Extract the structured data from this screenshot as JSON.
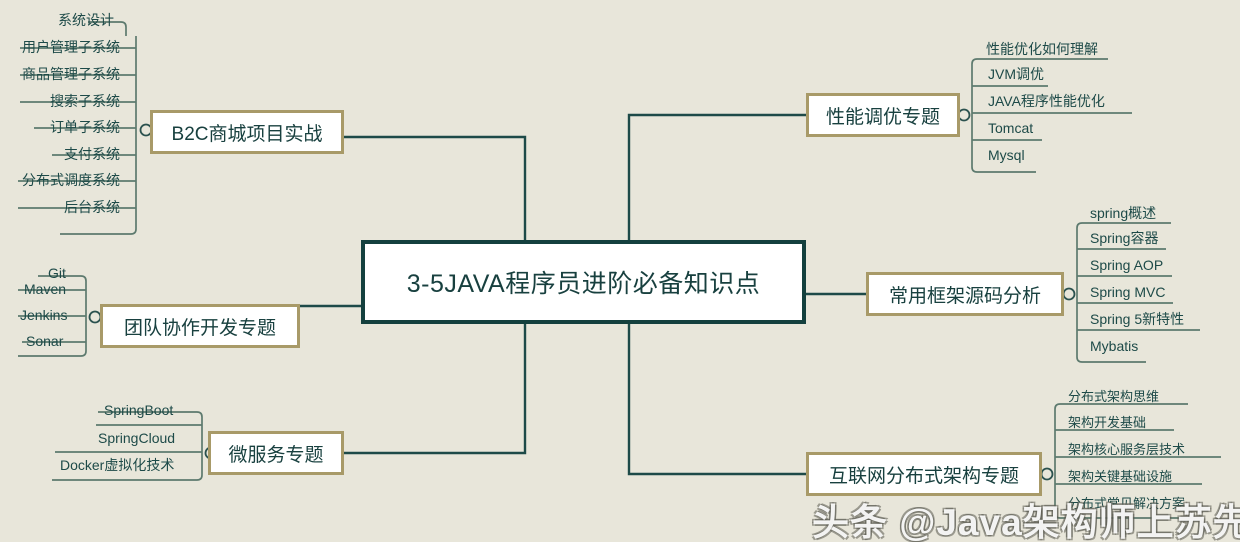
{
  "diagram": {
    "title": "3-5JAVA程序员进阶必备知识点",
    "background_color": "#e8e6da",
    "center_border_color": "#14403e",
    "branch_border_color": "#a89a68",
    "line_color": "#1d4a48",
    "text_color": "#18403f"
  },
  "center": {
    "label": "3-5JAVA程序员进阶必备知识点"
  },
  "branches": {
    "b2c": {
      "label": "B2C商城项目实战",
      "leaves": [
        {
          "label": "系统设计"
        },
        {
          "label": "用户管理子系统"
        },
        {
          "label": "商品管理子系统"
        },
        {
          "label": "搜索子系统"
        },
        {
          "label": "订单子系统"
        },
        {
          "label": "支付系统"
        },
        {
          "label": "分布式调度系统"
        },
        {
          "label": "后台系统"
        }
      ]
    },
    "team": {
      "label": "团队协作开发专题",
      "leaves": [
        {
          "label": "Git"
        },
        {
          "label": "Maven"
        },
        {
          "label": "Jenkins"
        },
        {
          "label": "Sonar"
        }
      ]
    },
    "micro": {
      "label": "微服务专题",
      "leaves": [
        {
          "label": "SpringBoot"
        },
        {
          "label": "SpringCloud"
        },
        {
          "label": "Docker虚拟化技术"
        }
      ]
    },
    "perf": {
      "label": "性能调优专题",
      "leaves": [
        {
          "label": "性能优化如何理解"
        },
        {
          "label": "JVM调优"
        },
        {
          "label": "JAVA程序性能优化"
        },
        {
          "label": "Tomcat"
        },
        {
          "label": "Mysql"
        }
      ]
    },
    "framework": {
      "label": "常用框架源码分析",
      "leaves": [
        {
          "label": "spring概述"
        },
        {
          "label": "Spring容器"
        },
        {
          "label": "Spring AOP"
        },
        {
          "label": "Spring MVC"
        },
        {
          "label": "Spring 5新特性"
        },
        {
          "label": "Mybatis"
        }
      ]
    },
    "distributed": {
      "label": "互联网分布式架构专题",
      "leaves": [
        {
          "label": "分布式架构思维"
        },
        {
          "label": "架构开发基础"
        },
        {
          "label": "架构核心服务层技术"
        },
        {
          "label": "架构关键基础设施"
        },
        {
          "label": "分布式常见解决方案"
        }
      ]
    }
  },
  "watermark": {
    "text": "头条 @Java架构师上苏先生"
  }
}
